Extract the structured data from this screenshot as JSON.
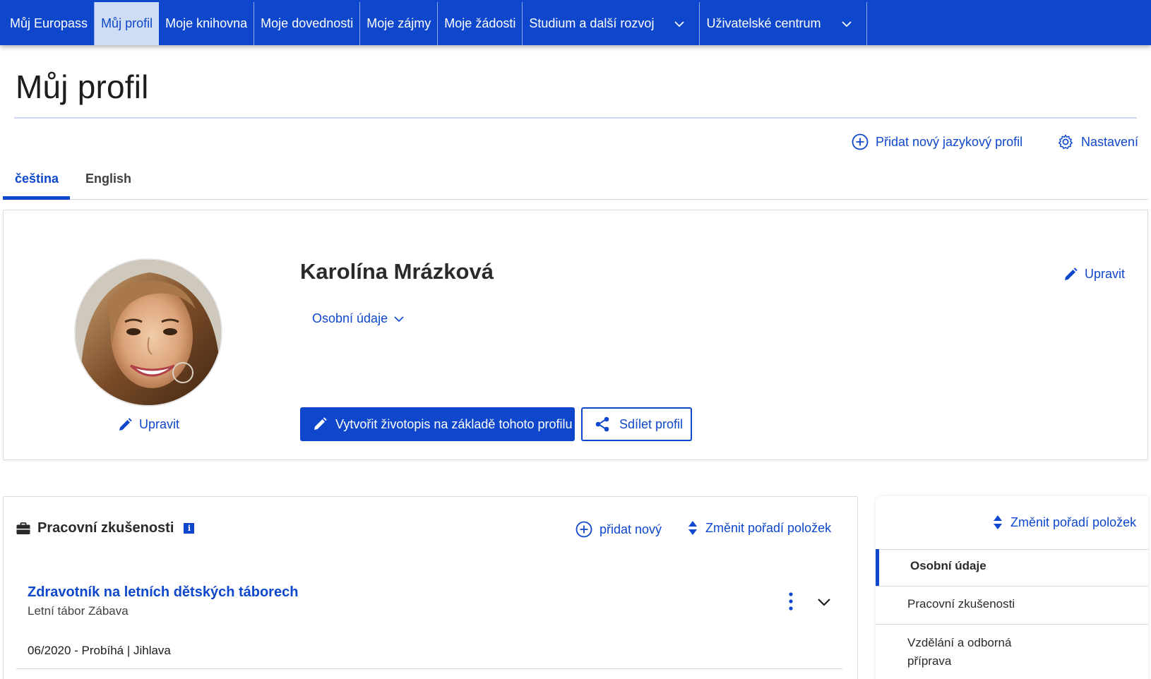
{
  "nav": {
    "items": [
      {
        "label": "Můj Europass",
        "active": false
      },
      {
        "label": "Můj profil",
        "active": true
      },
      {
        "label": "Moje knihovna",
        "active": false
      },
      {
        "label": "Moje dovednosti",
        "active": false
      },
      {
        "label": "Moje zájmy",
        "active": false
      },
      {
        "label": "Moje žádosti",
        "active": false
      },
      {
        "label": "Studium a další rozvoj",
        "active": false,
        "has_dropdown": true
      },
      {
        "label": "Uživatelské centrum",
        "active": false,
        "has_dropdown": true
      }
    ]
  },
  "page": {
    "title": "Můj profil",
    "add_language_profile": "Přidat nový jazykový profil",
    "settings": "Nastavení"
  },
  "tabs": [
    {
      "label": "čeština",
      "active": true
    },
    {
      "label": "English",
      "active": false
    }
  ],
  "profile": {
    "name": "Karolína Mrázková",
    "personal_details_toggle": "Osobní údaje",
    "edit_photo": "Upravit",
    "edit_profile": "Upravit",
    "create_cv_button": "Vytvořit životopis na základě tohoto profilu",
    "share_button": "Sdílet profil"
  },
  "work": {
    "section_title": "Pracovní zkušenosti",
    "info_icon": "i",
    "add_new": "přidat nový",
    "reorder": "Změnit pořadí položek",
    "entries": [
      {
        "title": "Zdravotník na letních dětských táborech",
        "employer": "Letní tábor Zábava",
        "meta": "06/2020 - Probíhá | Jihlava"
      }
    ]
  },
  "sidebar": {
    "reorder": "Změnit pořadí položek",
    "items": [
      {
        "label": "Osobní údaje",
        "active": true
      },
      {
        "label": "Pracovní zkušenosti",
        "active": false
      },
      {
        "label": "Vzdělání a odborná příprava",
        "active": false
      }
    ]
  },
  "colors": {
    "brand": "#0e47cb",
    "nav_active_bg": "#cfdcf5"
  }
}
